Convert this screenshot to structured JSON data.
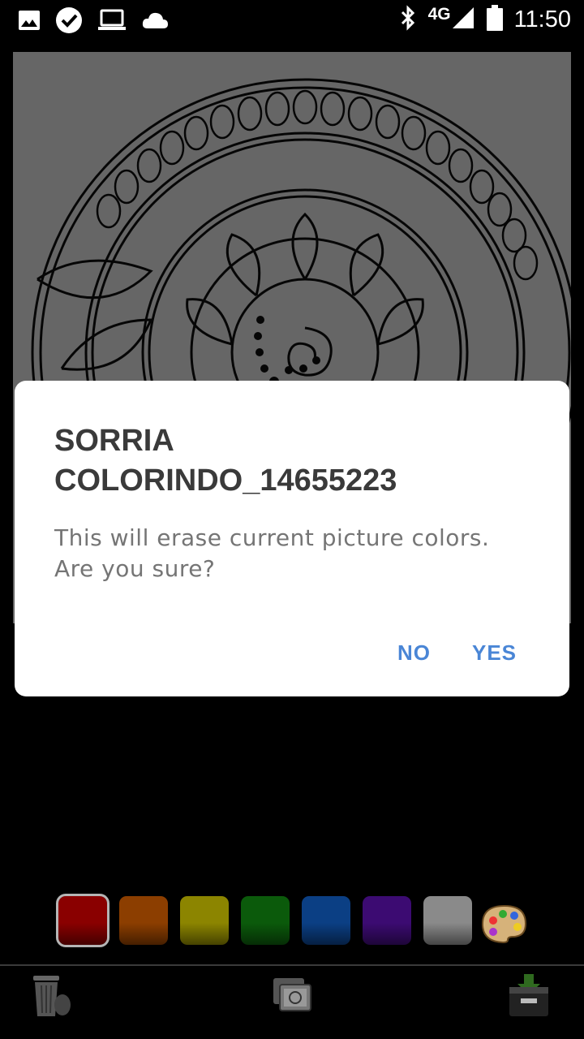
{
  "status_bar": {
    "time": "11:50",
    "network": "4G",
    "left_icons": [
      "image-icon",
      "check-circle-icon",
      "laptop-icon",
      "cloud-icon"
    ],
    "right_icons": [
      "bluetooth-icon",
      "signal-icon",
      "battery-icon"
    ]
  },
  "dialog": {
    "title": "SORRIA COLORINDO_14655223",
    "message": "This will erase current picture colors. Are you sure?",
    "no_label": "NO",
    "yes_label": "YES",
    "accent_color": "#4a86d6"
  },
  "palette": {
    "colors": [
      {
        "name": "red",
        "hex": "#8a0000",
        "selected": true
      },
      {
        "name": "orange",
        "hex": "#8c3e00",
        "selected": false
      },
      {
        "name": "yellow",
        "hex": "#8c8500",
        "selected": false
      },
      {
        "name": "green",
        "hex": "#0b5a0b",
        "selected": false
      },
      {
        "name": "blue",
        "hex": "#0b3f84",
        "selected": false
      },
      {
        "name": "purple",
        "hex": "#3c0b72",
        "selected": false
      },
      {
        "name": "gray",
        "hex": "#8a8a8a",
        "selected": false
      }
    ],
    "more_colors_icon": "paint-palette-icon"
  },
  "toolbar": {
    "icons": [
      "trash-icon",
      "gallery-icon",
      "save-icon"
    ]
  }
}
